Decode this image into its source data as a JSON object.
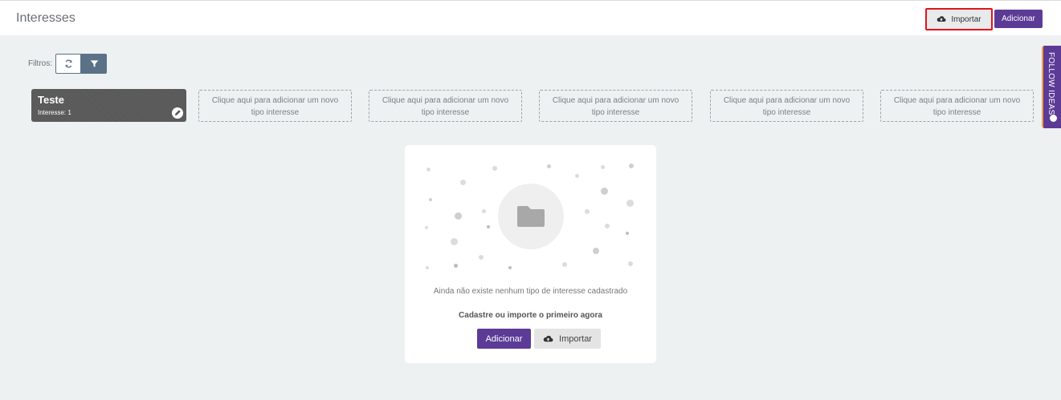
{
  "header": {
    "title": "Interesses",
    "import_label": "Importar",
    "add_label": "Adicionar"
  },
  "filters": {
    "label": "Filtros:",
    "refresh_icon": "refresh-icon",
    "filter_icon": "filter-funnel-icon"
  },
  "interest_cards": {
    "active": {
      "title": "Teste",
      "subtitle": "Interesse: 1",
      "edit_icon": "pencil-icon"
    },
    "placeholders": [
      "Clique aqui para adicionar um novo tipo interesse",
      "Clique aqui para adicionar um novo tipo interesse",
      "Clique aqui para adicionar um novo tipo interesse",
      "Clique aqui para adicionar um novo tipo interesse",
      "Clique aqui para adicionar um novo tipo interesse"
    ]
  },
  "side_tab": {
    "label": "FOLLOW IDEAS",
    "icon": "lightbulb-icon"
  },
  "empty_state": {
    "icon": "folder-icon",
    "message": "Ainda não existe nenhum tipo de interesse cadastrado",
    "cta": "Cadastre ou importe o primeiro agora",
    "add_label": "Adicionar",
    "import_label": "Importar"
  },
  "colors": {
    "primary": "#5c3b97",
    "filter_accent": "#5a7188",
    "highlight_border": "#e1141b",
    "background": "#eef1f2"
  }
}
